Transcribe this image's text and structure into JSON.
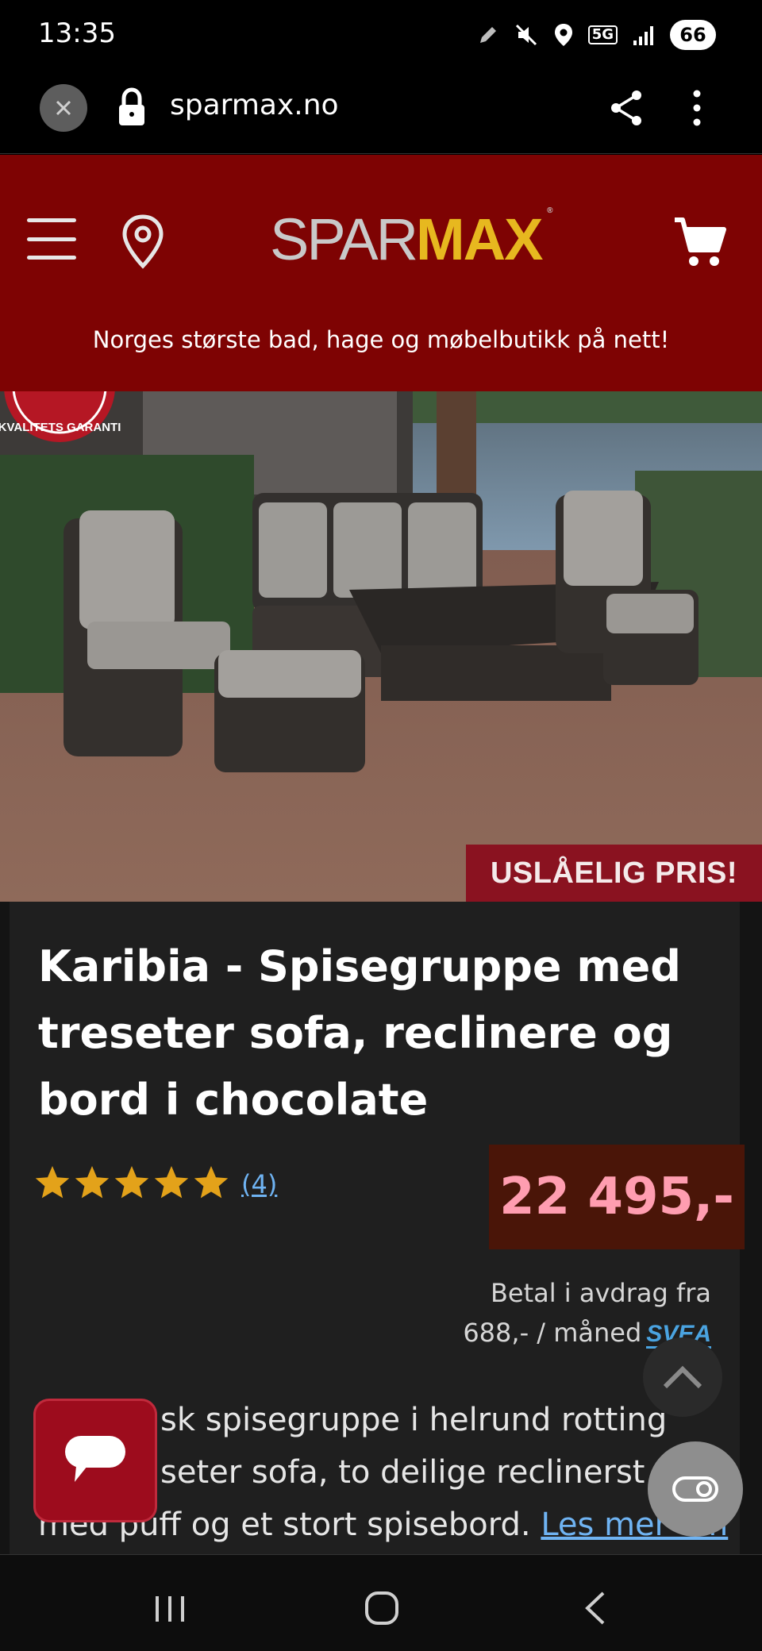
{
  "status_bar": {
    "time": "13:35",
    "network": "5G",
    "battery": "66",
    "icons": [
      "pen-icon",
      "mute-icon",
      "location-icon",
      "5g-icon",
      "signal-icon",
      "battery-icon"
    ]
  },
  "browser": {
    "url": "sparmax.no",
    "icons": [
      "close-icon",
      "lock-icon",
      "share-icon",
      "more-vertical-icon"
    ]
  },
  "header": {
    "logo_part1": "SPAR",
    "logo_part2": "MAX",
    "logo_mark": "®",
    "tagline": "Norges største bad, hage og møbelbutikk på nett!",
    "icons": [
      "menu-icon",
      "location-pin-icon",
      "cart-icon"
    ]
  },
  "hero": {
    "badge_text": "USLÅELIG PRIS!",
    "garanti_text": "KVALITETS GARANTI"
  },
  "product": {
    "title": "Karibia - Spisegruppe med treseter sofa, reclinere og bord i chocolate",
    "rating": 5,
    "review_count": "(4)",
    "price": "22 495,-",
    "installment_line1": "Betal i avdrag fra",
    "installment_line2": "688,- / måned",
    "installment_brand": "SVEA",
    "description": "Eksklusiv og klassisk spisegruppe i helrund rotting med treseter sofa, to deilige reclinerstoler med puff og et stort spisebord.",
    "description_visible": "sk spisegruppe i helrund rotting",
    "description_line2": "seter sofa, to deilige reclinerst",
    "description_line3": "med puff og et stort spisebord.",
    "read_more": "Les mer om"
  },
  "colors": {
    "header_bg": "#7e0303",
    "logo_max": "#e7b81f",
    "price_text": "#ff9db0",
    "price_bg": "#4a1508",
    "link": "#6fb3f2",
    "chat_button": "#9d0c1d"
  },
  "nav": {
    "icons": [
      "recent-apps-icon",
      "home-icon",
      "back-icon"
    ]
  }
}
